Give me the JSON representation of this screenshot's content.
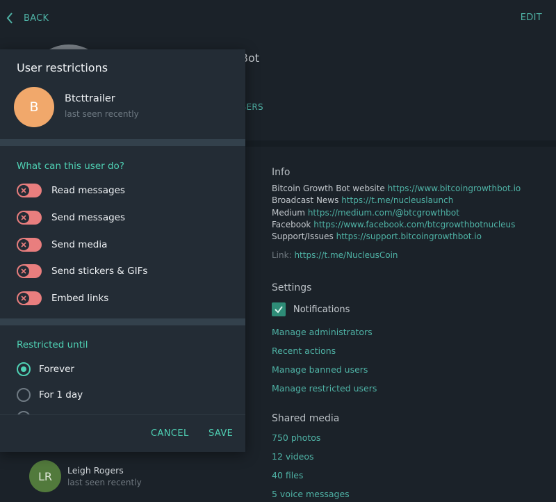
{
  "topbar": {
    "back_label": "BACK",
    "edit_label": "EDIT"
  },
  "background": {
    "title_fragment": "Bot",
    "members_fragment": "BERS"
  },
  "info": {
    "heading": "Info",
    "lines": [
      {
        "label": "Bitcoin Growth Bot website",
        "url": "https://www.bitcoingrowthbot.io"
      },
      {
        "label": "Broadcast News",
        "url": "https://t.me/nucleuslaunch"
      },
      {
        "label": "Medium",
        "url": "https://medium.com/@btcgrowthbot"
      },
      {
        "label": "Facebook",
        "url": "https://www.facebook.com/btcgrowthbotnucleus"
      },
      {
        "label": "Support/Issues",
        "url": "https://support.bitcoingrowthbot.io"
      }
    ],
    "link_label": "Link:",
    "link_url": "https://t.me/NucleusCoin"
  },
  "settings": {
    "heading": "Settings",
    "notifications_label": "Notifications",
    "notifications_checked": true,
    "links": [
      "Manage administrators",
      "Recent actions",
      "Manage banned users",
      "Manage restricted users"
    ]
  },
  "shared_media": {
    "heading": "Shared media",
    "items": [
      "750 photos",
      "12 videos",
      "40 files",
      "5 voice messages"
    ]
  },
  "member": {
    "initials": "LR",
    "name": "Leigh Rogers",
    "status": "last seen recently",
    "color": "#527a3c"
  },
  "modal": {
    "title": "User restrictions",
    "user": {
      "initial": "B",
      "name": "Btcttrailer",
      "status": "last seen recently",
      "color": "#f1a86b"
    },
    "permissions_heading": "What can this user do?",
    "permissions": [
      {
        "label": "Read messages",
        "enabled": false
      },
      {
        "label": "Send messages",
        "enabled": false
      },
      {
        "label": "Send media",
        "enabled": false
      },
      {
        "label": "Send stickers & GIFs",
        "enabled": false
      },
      {
        "label": "Embed links",
        "enabled": false
      }
    ],
    "restricted_heading": "Restricted until",
    "durations": [
      {
        "label": "Forever",
        "selected": true
      },
      {
        "label": "For 1 day",
        "selected": false
      }
    ],
    "cancel_label": "CANCEL",
    "save_label": "SAVE"
  },
  "colors": {
    "accent": "#4fd1b4",
    "link": "#4fb3a6",
    "toggle_off": "#e97e7e",
    "panel": "#232c35",
    "background": "#1b2229"
  }
}
